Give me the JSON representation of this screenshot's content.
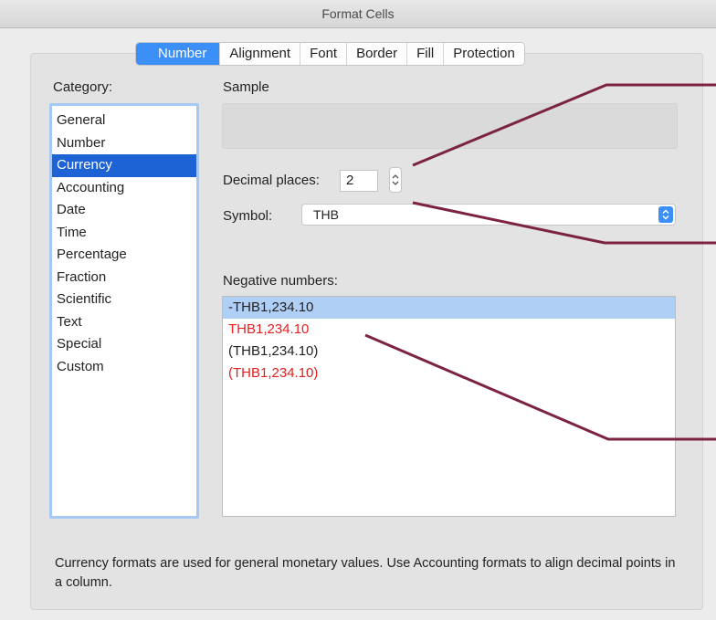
{
  "window": {
    "title": "Format Cells"
  },
  "tabs": [
    {
      "label": "Number",
      "active": true
    },
    {
      "label": "Alignment",
      "active": false
    },
    {
      "label": "Font",
      "active": false
    },
    {
      "label": "Border",
      "active": false
    },
    {
      "label": "Fill",
      "active": false
    },
    {
      "label": "Protection",
      "active": false
    }
  ],
  "category": {
    "label": "Category:",
    "items": [
      "General",
      "Number",
      "Currency",
      "Accounting",
      "Date",
      "Time",
      "Percentage",
      "Fraction",
      "Scientific",
      "Text",
      "Special",
      "Custom"
    ],
    "selected": "Currency"
  },
  "sample": {
    "label": "Sample",
    "value": ""
  },
  "decimal_places": {
    "label": "Decimal places:",
    "value": "2"
  },
  "symbol": {
    "label": "Symbol:",
    "value": "THB"
  },
  "negative_numbers": {
    "label": "Negative numbers:",
    "items": [
      {
        "text": "-THB1,234.10",
        "color": "#222222",
        "selected": true
      },
      {
        "text": "THB1,234.10",
        "color": "#e31f1f",
        "selected": false
      },
      {
        "text": "(THB1,234.10)",
        "color": "#222222",
        "selected": false
      },
      {
        "text": "(THB1,234.10)",
        "color": "#e31f1f",
        "selected": false
      }
    ]
  },
  "description": "Currency formats are used for general monetary values.  Use Accounting formats to align decimal points in a column.",
  "colors": {
    "accent": "#3d8ff8",
    "selection": "#1d63d6",
    "annotation_line": "#7b2341",
    "negative_red": "#e31f1f"
  },
  "icons": {
    "stepper": "up-down-stepper-icon",
    "select": "chevron-up-down-icon"
  }
}
